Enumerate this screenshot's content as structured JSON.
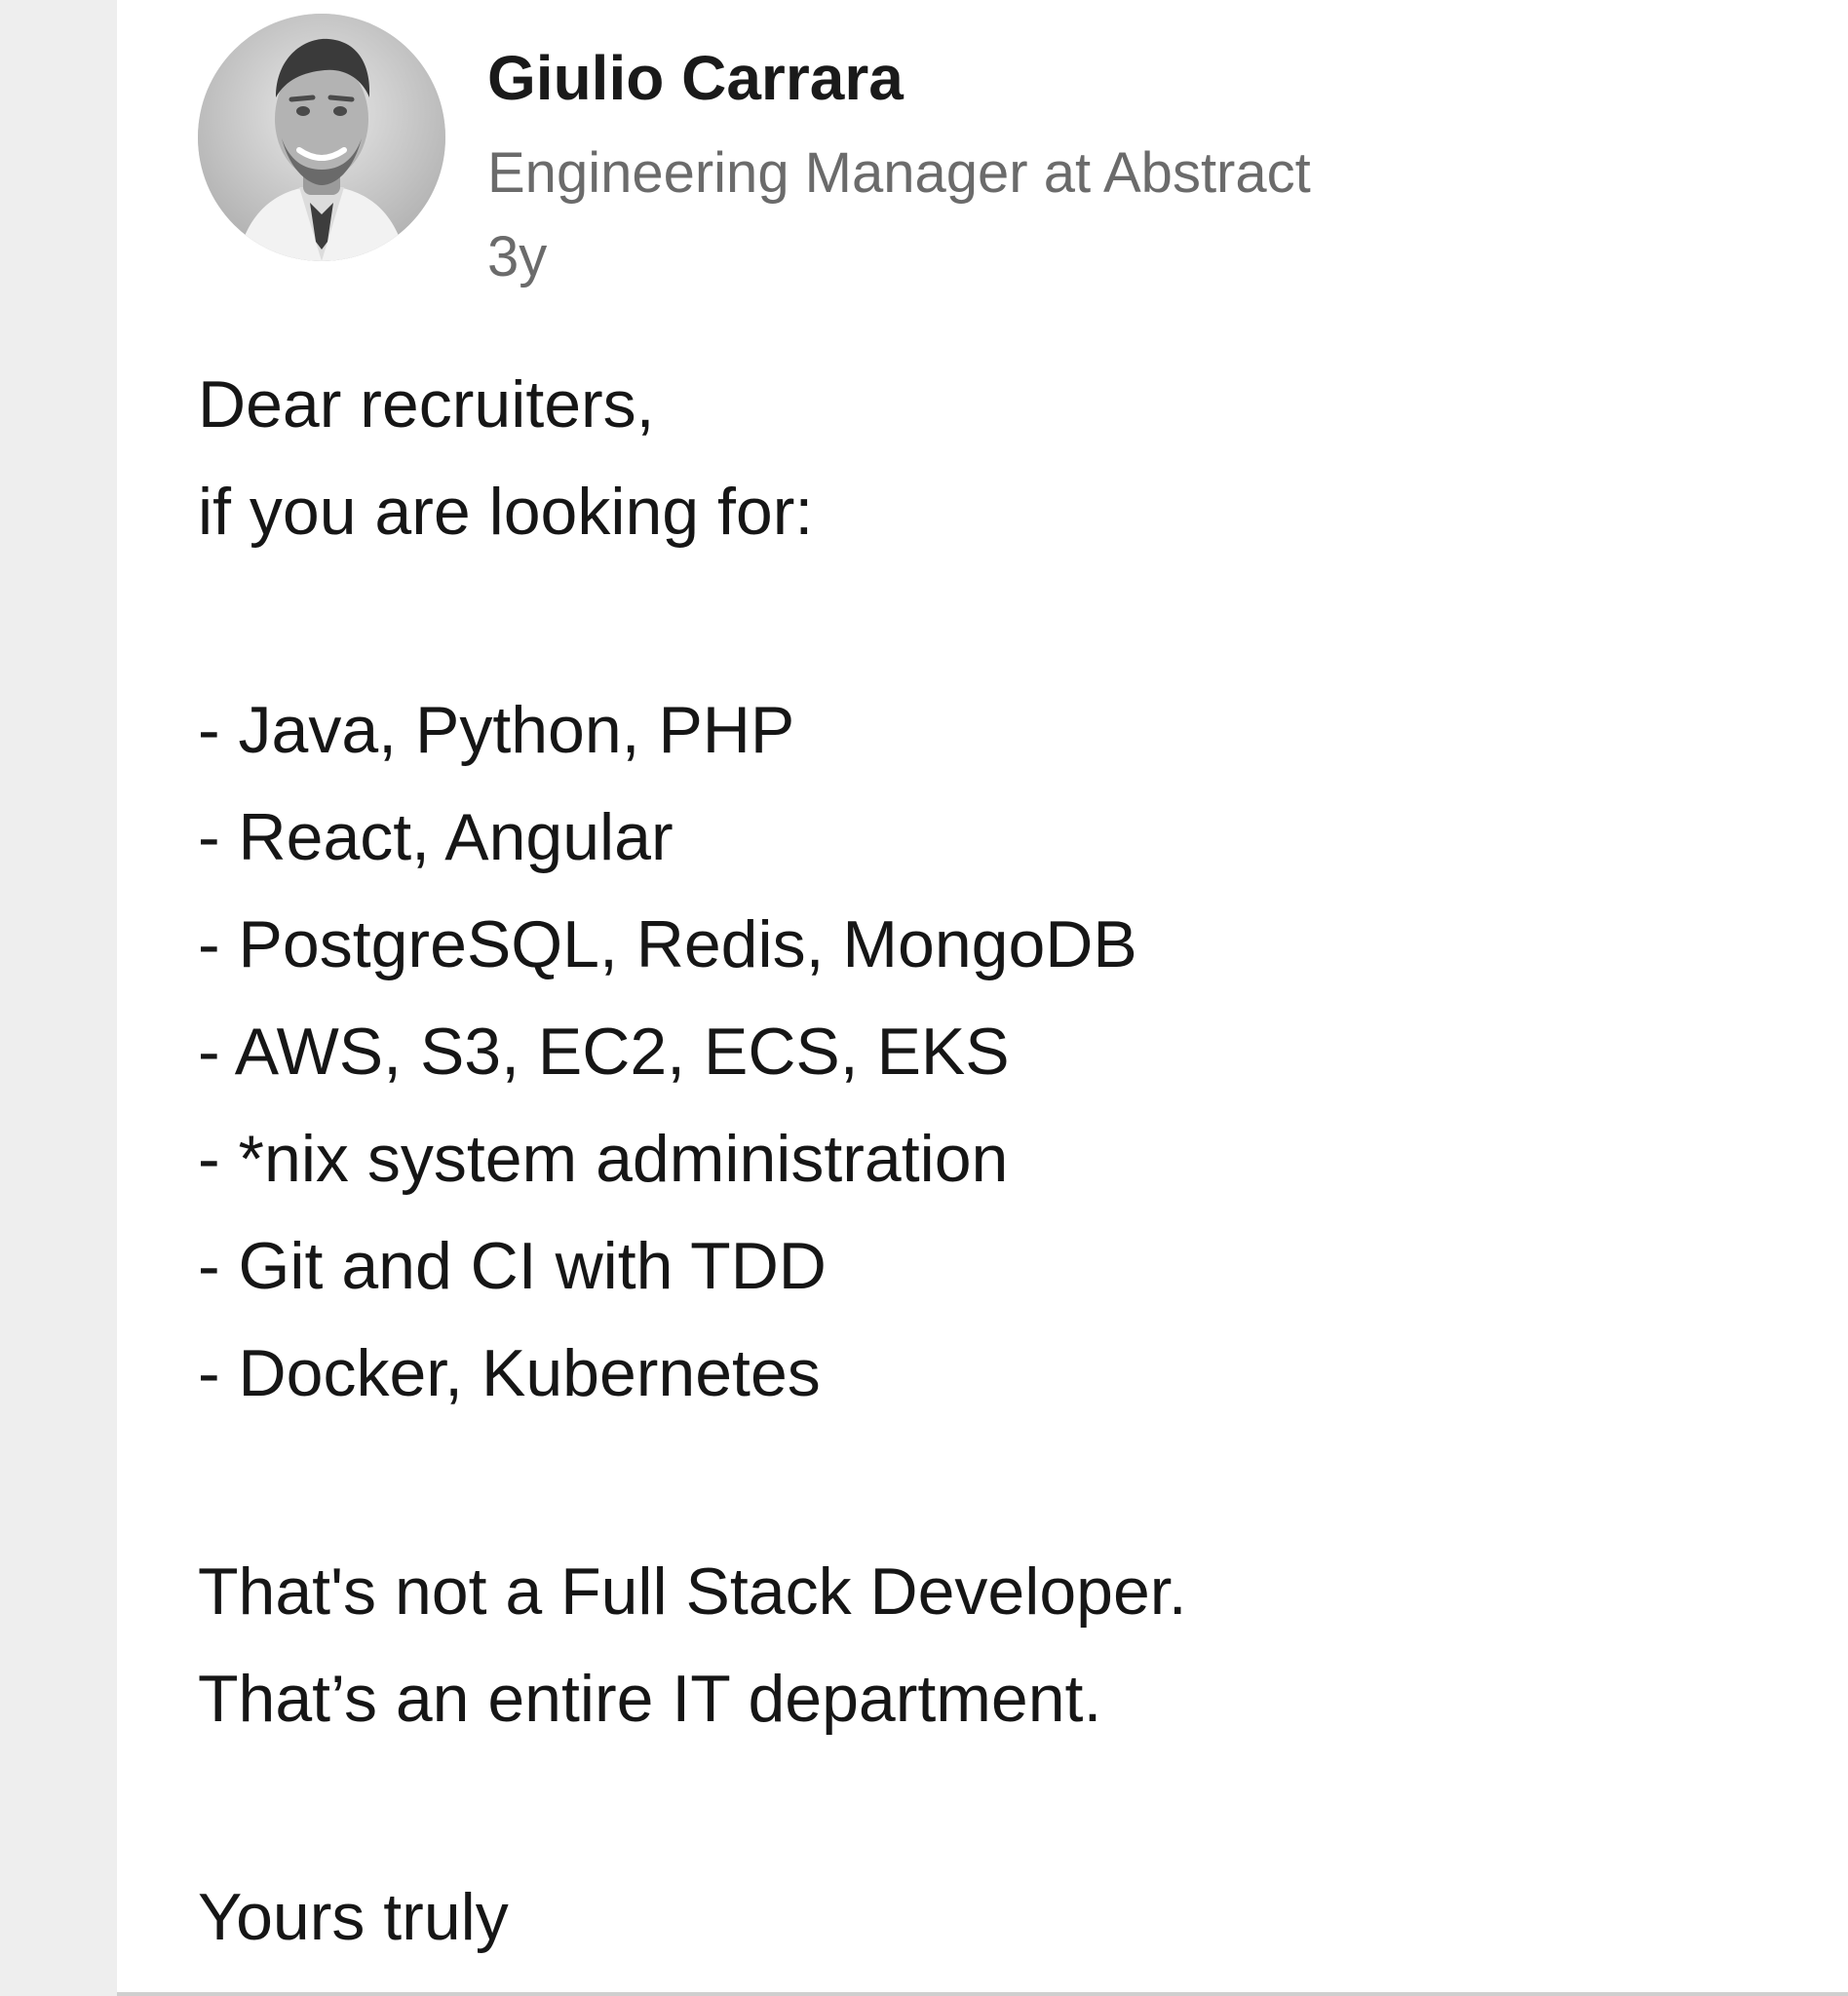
{
  "author": {
    "name": "Giulio Carrara",
    "headline": "Engineering Manager at Abstract",
    "time": "3y",
    "avatar_icon": "profile-photo"
  },
  "post": {
    "greeting": "Dear recruiters,",
    "intro": "if you are looking for:",
    "skills": [
      "- Java, Python, PHP",
      "- React, Angular",
      "- PostgreSQL, Redis, MongoDB",
      "- AWS, S3, EC2, ECS, EKS",
      "- *nix system administration",
      "- Git and CI with TDD",
      "- Docker, Kubernetes"
    ],
    "conclusion": [
      "That's not a Full Stack Developer.",
      "That’s an entire IT department."
    ],
    "signoff": "Yours truly"
  },
  "colors": {
    "page_background": "#ffffff",
    "gutter": "#eeeeee",
    "name_text": "#1a1a1a",
    "secondary_text": "#6b6b6b",
    "body_text": "#161616"
  }
}
